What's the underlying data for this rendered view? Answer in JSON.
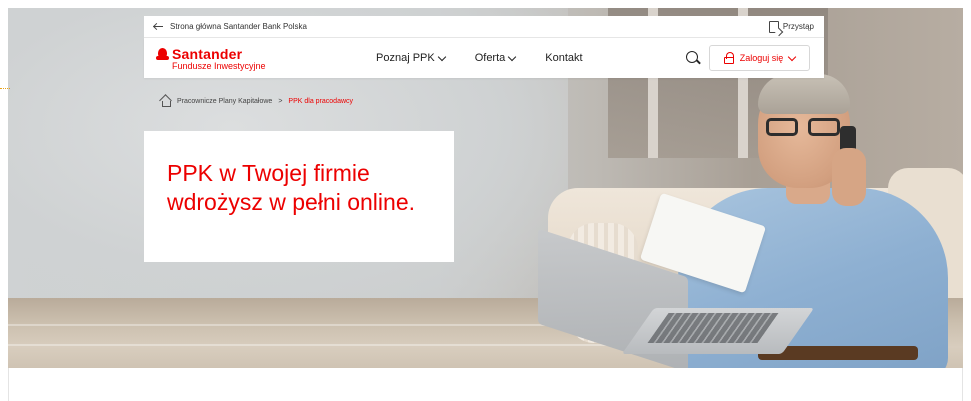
{
  "topbar": {
    "back_link_label": "Strona główna Santander Bank Polska",
    "access_label": "Przystąp"
  },
  "logo": {
    "name": "Santander",
    "subtitle": "Fundusze Inwestycyjne"
  },
  "nav": {
    "items": [
      {
        "label": "Poznaj PPK",
        "has_dropdown": true
      },
      {
        "label": "Oferta",
        "has_dropdown": true
      },
      {
        "label": "Kontakt",
        "has_dropdown": false
      }
    ],
    "login_label": "Zaloguj się"
  },
  "breadcrumb": {
    "items": [
      "Pracownicze Plany Kapitałowe",
      "PPK dla pracodawcy"
    ],
    "separator": ">"
  },
  "hero": {
    "headline_line1": "PPK w Twojej firmie",
    "headline_line2": "wdrożysz w pełni online."
  },
  "colors": {
    "brand": "#ec0000",
    "text": "#222222"
  },
  "icons": [
    "arrow-left-icon",
    "document-icon",
    "santander-flame-icon",
    "chevron-down-icon",
    "search-icon",
    "lock-icon",
    "home-icon"
  ]
}
